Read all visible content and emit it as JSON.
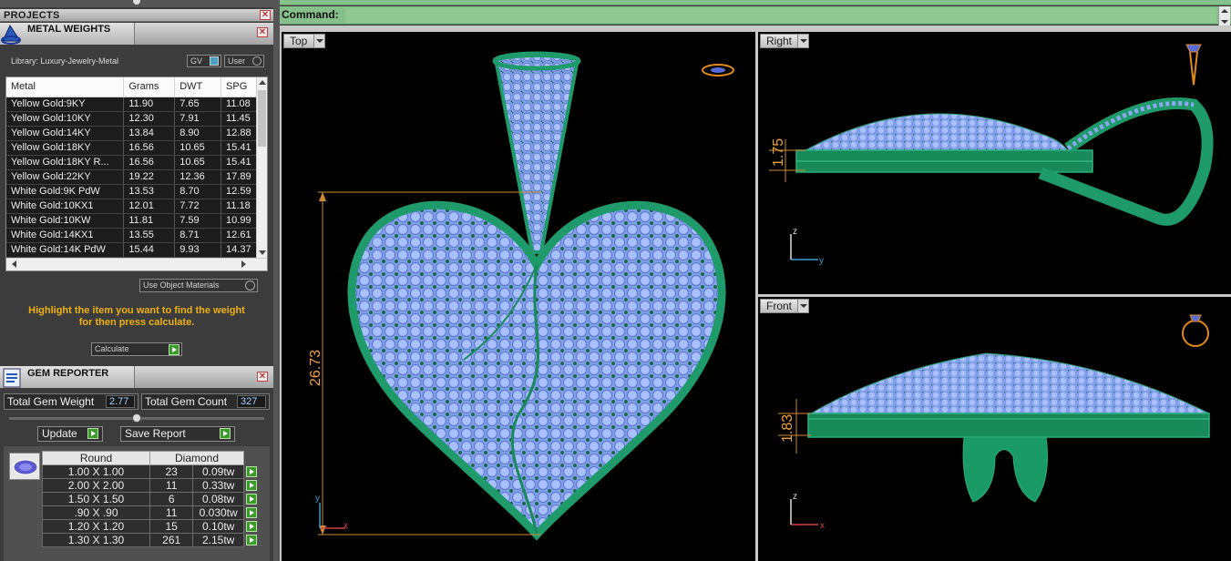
{
  "panels": {
    "projects": {
      "title": "PROJECTS"
    },
    "metal_weights": {
      "title": "METAL WEIGHTS",
      "library_label": "Library: Luxury-Jewelry-Metal",
      "gv_label": "GV",
      "user_label": "User",
      "columns": [
        "Metal",
        "Grams",
        "DWT",
        "SPG"
      ],
      "rows": [
        [
          "Yellow Gold:9KY",
          "11.90",
          "7.65",
          "11.08"
        ],
        [
          "Yellow Gold:10KY",
          "12.30",
          "7.91",
          "11.45"
        ],
        [
          "Yellow Gold:14KY",
          "13.84",
          "8.90",
          "12.88"
        ],
        [
          "Yellow Gold:18KY",
          "16.56",
          "10.65",
          "15.41"
        ],
        [
          "Yellow Gold:18KY R...",
          "16.56",
          "10.65",
          "15.41"
        ],
        [
          "Yellow Gold:22KY",
          "19.22",
          "12.36",
          "17.89"
        ],
        [
          "White Gold:9K PdW",
          "13.53",
          "8.70",
          "12.59"
        ],
        [
          "White Gold:10KX1",
          "12.01",
          "7.72",
          "11.18"
        ],
        [
          "White Gold:10KW",
          "11.81",
          "7.59",
          "10.99"
        ],
        [
          "White Gold:14KX1",
          "13.55",
          "8.71",
          "12.61"
        ],
        [
          "White Gold:14K PdW",
          "15.44",
          "9.93",
          "14.37"
        ]
      ],
      "use_object_materials": "Use Object Materials",
      "hint_line1": "Highlight the item you want to find the weight",
      "hint_line2": "for then press calculate.",
      "calculate": "Calculate"
    },
    "gem_reporter": {
      "title": "GEM REPORTER",
      "total_weight_label": "Total Gem Weight",
      "total_weight_value": "2.77",
      "total_count_label": "Total Gem Count",
      "total_count_value": "327",
      "update": "Update",
      "save_report": "Save Report",
      "shape_header": "Round",
      "material_header": "Diamond",
      "rows": [
        [
          "1.00 X 1.00",
          "23",
          "0.09tw"
        ],
        [
          "2.00 X 2.00",
          "11",
          "0.33tw"
        ],
        [
          "1.50 X 1.50",
          "6",
          "0.08tw"
        ],
        [
          ".90 X .90",
          "11",
          "0.030tw"
        ],
        [
          "1.20 X 1.20",
          "15",
          "0.10tw"
        ],
        [
          "1.30 X 1.30",
          "261",
          "2.15tw"
        ]
      ]
    }
  },
  "command": {
    "label": "Command:",
    "value": ""
  },
  "viewports": {
    "top": {
      "label": "Top",
      "dimension": "26.73",
      "axis_x": "x",
      "axis_y": "y"
    },
    "right": {
      "label": "Right",
      "dimension": "1.75",
      "axis_x": "y",
      "axis_y": "z"
    },
    "front": {
      "label": "Front",
      "dimension": "1.83",
      "axis_x": "x",
      "axis_y": "z"
    }
  },
  "colors": {
    "command_bar": "#86c08a",
    "metal_green": "#1f9a6a",
    "gem_blue": "#8aa8f0",
    "dimension": "#f0a040",
    "hint": "#f0b010"
  },
  "icons": [
    "close-icon",
    "metal-weights-icon",
    "gem-reporter-icon",
    "play-arrow-icon",
    "compass-icon",
    "pendant-icon",
    "ring-icon",
    "dropdown-arrow-icon"
  ]
}
